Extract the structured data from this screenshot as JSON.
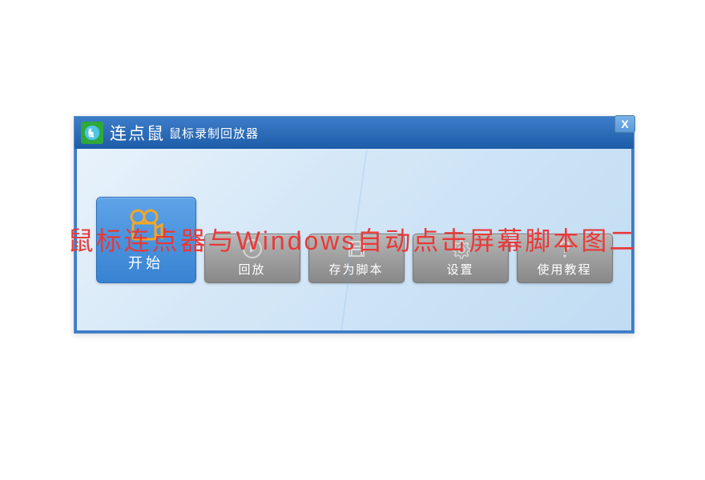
{
  "titlebar": {
    "main": "连点鼠",
    "sub": "鼠标录制回放器",
    "close": "X"
  },
  "buttons": {
    "start": "开始",
    "replay": "回放",
    "saveScript": "存为脚本",
    "settings": "设置",
    "tutorial": "使用教程"
  },
  "overlay": "鼠标连点器与Windows自动点击屏幕脚本图二"
}
